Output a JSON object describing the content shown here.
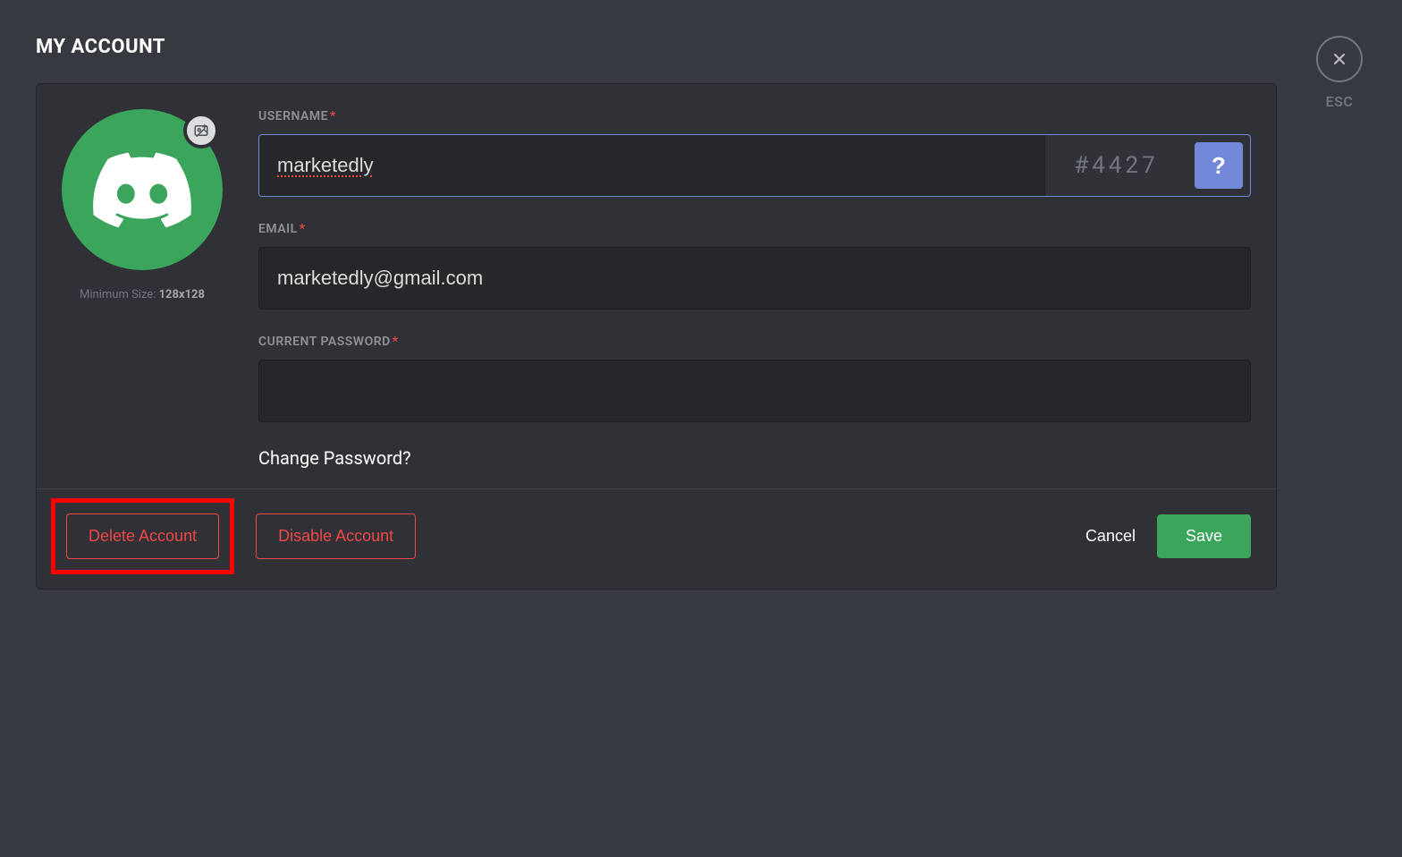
{
  "page": {
    "title": "MY ACCOUNT"
  },
  "avatar": {
    "min_size_label": "Minimum Size:",
    "min_size_value": "128x128"
  },
  "form": {
    "username": {
      "label": "USERNAME",
      "value": "marketedly",
      "discriminator": "#4427",
      "help": "?"
    },
    "email": {
      "label": "EMAIL",
      "value": "marketedly@gmail.com"
    },
    "password": {
      "label": "CURRENT PASSWORD",
      "value": ""
    },
    "change_password_link": "Change Password?"
  },
  "buttons": {
    "delete": "Delete Account",
    "disable": "Disable Account",
    "cancel": "Cancel",
    "save": "Save"
  },
  "close": {
    "label": "ESC"
  }
}
